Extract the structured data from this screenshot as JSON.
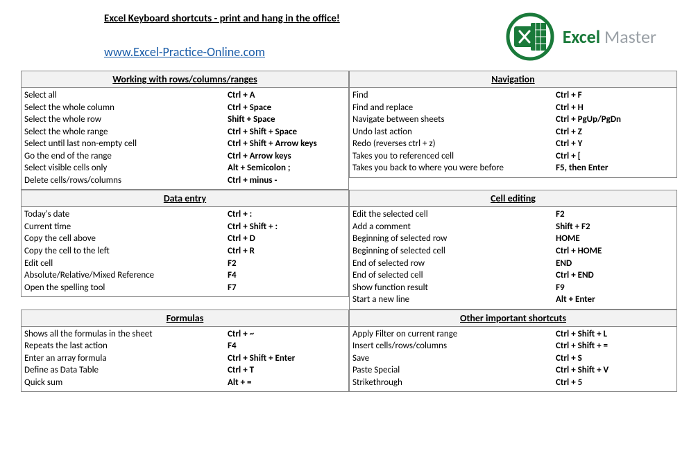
{
  "header": {
    "title": "Excel Keyboard shortcuts - print and hang in the office!",
    "link_text": "www.Excel-Practice-Online.com",
    "link_href": "http://www.Excel-Practice-Online.com",
    "logo_excel": "Excel",
    "logo_master": "Master"
  },
  "sections": {
    "rows_cols": {
      "title": "Working with rows/columns/ranges",
      "items": [
        {
          "desc": "Select all",
          "key": "Ctrl + A"
        },
        {
          "desc": "Select the whole column",
          "key": "Ctrl + Space"
        },
        {
          "desc": "Select the whole row",
          "key": "Shift + Space"
        },
        {
          "desc": "Select the whole range",
          "key": "Ctrl + Shift + Space"
        },
        {
          "desc": "Select until last non-empty cell",
          "key": "Ctrl + Shift + Arrow keys"
        },
        {
          "desc": "Go the end of the range",
          "key": "Ctrl + Arrow keys"
        },
        {
          "desc": "Select visible cells only",
          "key": "Alt + Semicolon ;"
        },
        {
          "desc": "Delete cells/rows/columns",
          "key": "Ctrl + minus -"
        }
      ]
    },
    "navigation": {
      "title": "Navigation",
      "items": [
        {
          "desc": "Find",
          "key": "Ctrl + F"
        },
        {
          "desc": "Find and replace",
          "key": "Ctrl + H"
        },
        {
          "desc": "Navigate between sheets",
          "key": "Ctrl + PgUp/PgDn"
        },
        {
          "desc": "Undo last action",
          "key": "Ctrl + Z"
        },
        {
          "desc": "Redo (reverses ctrl + z)",
          "key": "Ctrl + Y"
        },
        {
          "desc": "Takes you to referenced cell",
          "key": "Ctrl + ["
        },
        {
          "desc": "Takes you back to where you were before",
          "key": "F5, then Enter"
        }
      ]
    },
    "data_entry": {
      "title": "Data entry",
      "items": [
        {
          "desc": "Today's date",
          "key": "Ctrl + :"
        },
        {
          "desc": "Current time",
          "key": "Ctrl + Shift + :"
        },
        {
          "desc": "Copy the cell above",
          "key": "Ctrl + D"
        },
        {
          "desc": "Copy the cell to the left",
          "key": "Ctrl + R"
        },
        {
          "desc": "Edit cell",
          "key": "F2"
        },
        {
          "desc": "Absolute/Relative/Mixed Reference",
          "key": "F4"
        },
        {
          "desc": "Open the spelling tool",
          "key": "F7"
        }
      ]
    },
    "cell_editing": {
      "title": "Cell editing",
      "items": [
        {
          "desc": "Edit the selected cell",
          "key": "F2"
        },
        {
          "desc": "Add a comment",
          "key": "Shift + F2"
        },
        {
          "desc": "Beginning of selected row",
          "key": "HOME"
        },
        {
          "desc": "Beginning of selected cell",
          "key": "Ctrl + HOME"
        },
        {
          "desc": "End of selected row",
          "key": "END"
        },
        {
          "desc": "End of selected cell",
          "key": "Ctrl + END"
        },
        {
          "desc": "Show function result",
          "key": "F9"
        },
        {
          "desc": "Start a new line",
          "key": "Alt + Enter"
        }
      ]
    },
    "formulas": {
      "title": "Formulas",
      "items": [
        {
          "desc": "Shows all the formulas in the sheet",
          "key": "Ctrl + ~"
        },
        {
          "desc": "Repeats the last action",
          "key": "F4"
        },
        {
          "desc": "Enter an array formula",
          "key": "Ctrl + Shift + Enter"
        },
        {
          "desc": "Define as Data Table",
          "key": "Ctrl + T"
        },
        {
          "desc": "Quick sum",
          "key": "Alt + ="
        }
      ]
    },
    "other": {
      "title": "Other important shortcuts",
      "items": [
        {
          "desc": "Apply Filter on current range",
          "key": "Ctrl + Shift + L"
        },
        {
          "desc": "Insert cells/rows/columns",
          "key": "Ctrl + Shift + ="
        },
        {
          "desc": "Save",
          "key": "Ctrl + S"
        },
        {
          "desc": "Paste Special",
          "key": "Ctrl + Shift + V"
        },
        {
          "desc": "Strikethrough",
          "key": "Ctrl + 5"
        }
      ]
    }
  }
}
